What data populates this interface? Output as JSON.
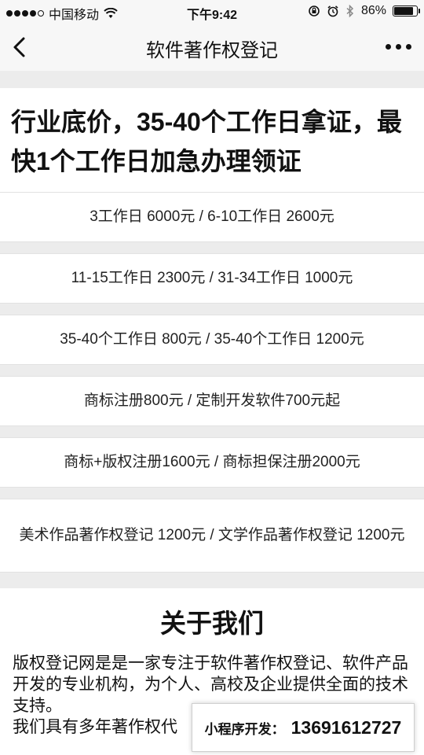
{
  "status_bar": {
    "carrier": "中国移动",
    "time": "下午9:42",
    "battery": "86%",
    "battery_level": 0.86,
    "icons": [
      "signal-dots-icon",
      "wifi-icon",
      "rotation-lock-icon",
      "alarm-icon",
      "bluetooth-icon",
      "battery-icon"
    ]
  },
  "nav": {
    "title": "软件著作权登记",
    "icons": [
      "back-chevron-icon",
      "more-dots-icon"
    ]
  },
  "headline": "行业底价，35-40个工作日拿证，最快1个工作日加急办理领证",
  "price_rows": [
    "3工作日 6000元 / 6-10工作日 2600元",
    "11-15工作日 2300元 / 31-34工作日 1000元",
    "35-40个工作日 800元 / 35-40个工作日 1200元",
    "商标注册800元 / 定制开发软件700元起",
    "商标+版权注册1600元 / 商标担保注册2000元",
    "美术作品著作权登记 1200元 / 文学作品著作权登记 1200元"
  ],
  "about": {
    "title": "关于我们",
    "paragraph1": "版权登记网是是一家专注于软件著作权登记、软件产品开发的专业机构，为个人、高校及企业提供全面的技术支持。",
    "paragraph2": "我们具有多年著作权代"
  },
  "contact": {
    "label": "小程序开发：",
    "phone": "13691612727"
  }
}
